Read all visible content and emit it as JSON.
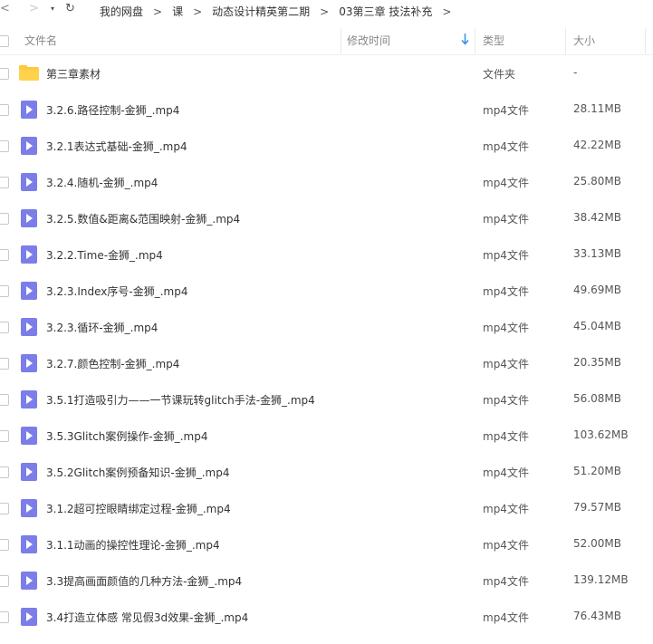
{
  "nav": {
    "back": "<",
    "forward": ">",
    "dropdown": "▾",
    "refresh": "↻",
    "crumbs": [
      "我的网盘",
      "课",
      "动态设计精英第二期",
      "03第三章 技法补充"
    ],
    "sep": ">"
  },
  "header": {
    "name": "文件名",
    "modified": "修改时间",
    "type": "类型",
    "size": "大小",
    "sort_icon": "arrow-down-icon"
  },
  "files": [
    {
      "name": "第三章素材",
      "type": "文件夹",
      "size": "-",
      "icon": "folder-icon"
    },
    {
      "name": "3.2.6.路径控制-金狮_.mp4",
      "type": "mp4文件",
      "size": "28.11MB",
      "icon": "video-icon"
    },
    {
      "name": "3.2.1表达式基础-金狮_.mp4",
      "type": "mp4文件",
      "size": "42.22MB",
      "icon": "video-icon"
    },
    {
      "name": "3.2.4.随机-金狮_.mp4",
      "type": "mp4文件",
      "size": "25.80MB",
      "icon": "video-icon"
    },
    {
      "name": "3.2.5.数值&距离&范围映射-金狮_.mp4",
      "type": "mp4文件",
      "size": "38.42MB",
      "icon": "video-icon"
    },
    {
      "name": "3.2.2.Time-金狮_.mp4",
      "type": "mp4文件",
      "size": "33.13MB",
      "icon": "video-icon"
    },
    {
      "name": "3.2.3.Index序号-金狮_.mp4",
      "type": "mp4文件",
      "size": "49.69MB",
      "icon": "video-icon"
    },
    {
      "name": "3.2.3.循环-金狮_.mp4",
      "type": "mp4文件",
      "size": "45.04MB",
      "icon": "video-icon"
    },
    {
      "name": "3.2.7.颜色控制-金狮_.mp4",
      "type": "mp4文件",
      "size": "20.35MB",
      "icon": "video-icon"
    },
    {
      "name": "3.5.1打造吸引力——一节课玩转glitch手法-金狮_.mp4",
      "type": "mp4文件",
      "size": "56.08MB",
      "icon": "video-icon"
    },
    {
      "name": "3.5.3Glitch案例操作-金狮_.mp4",
      "type": "mp4文件",
      "size": "103.62MB",
      "icon": "video-icon"
    },
    {
      "name": "3.5.2Glitch案例预备知识-金狮_.mp4",
      "type": "mp4文件",
      "size": "51.20MB",
      "icon": "video-icon"
    },
    {
      "name": "3.1.2超可控眼睛绑定过程-金狮_.mp4",
      "type": "mp4文件",
      "size": "79.57MB",
      "icon": "video-icon"
    },
    {
      "name": "3.1.1动画的操控性理论-金狮_.mp4",
      "type": "mp4文件",
      "size": "52.00MB",
      "icon": "video-icon"
    },
    {
      "name": "3.3提高画面颜值的几种方法-金狮_.mp4",
      "type": "mp4文件",
      "size": "139.12MB",
      "icon": "video-icon"
    },
    {
      "name": "3.4打造立体感 常见假3d效果-金狮_.mp4",
      "type": "mp4文件",
      "size": "76.43MB",
      "icon": "video-icon"
    }
  ],
  "colors": {
    "video_icon": "#7b7ee8",
    "folder_icon": "#ffc83d",
    "accent": "#3b8ee8"
  }
}
